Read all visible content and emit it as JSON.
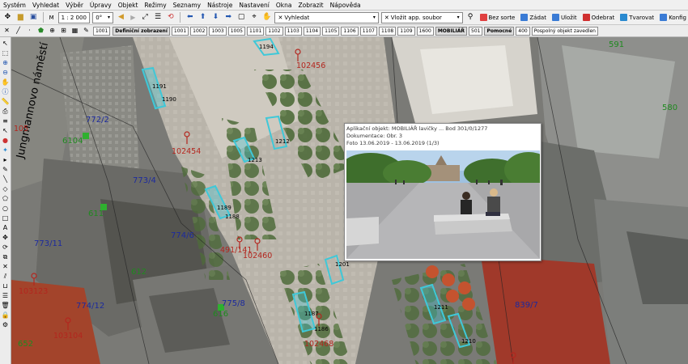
{
  "menu": [
    "Systém",
    "Vyhledat",
    "Výběr",
    "Úpravy",
    "Objekt",
    "Režimy",
    "Seznamy",
    "Nástroje",
    "Nastavení",
    "Okna",
    "Zobrazit",
    "Nápověda"
  ],
  "toolbar": {
    "scale_prefix": "M",
    "scale_value": "1 : 2 000",
    "rotation_value": "0°",
    "search_value": "Vyhledat",
    "search_clear": "✕",
    "file_type_value": "Vložit app. soubor",
    "buttons": {
      "bezsortz": "Bez sorte",
      "zadat": "Zádat",
      "ulozit": "Uložit",
      "odebrat": "Odebrat",
      "tvarovani": "Tvarovat",
      "konfig": "Konfig"
    }
  },
  "layers": {
    "mode_btn": "1001",
    "items": [
      "Definiční zobrazení",
      "1001",
      "1002",
      "1003",
      "1005",
      "1101",
      "1102",
      "1103",
      "1104",
      "1105",
      "1106",
      "1107",
      "1108",
      "1109",
      "1600",
      "MOBILIÁŘ",
      "501",
      "Pomocné",
      "400",
      "Pospolný objekt zavedlen"
    ]
  },
  "map": {
    "street_name": "Jungmannovo náměstí",
    "labels": {
      "red": [
        "102456",
        "102454",
        "102460",
        "102468",
        "103123",
        "103104",
        "491/141",
        "105",
        "124"
      ],
      "blue": [
        "772/2",
        "773/4",
        "774/6",
        "773/11",
        "775/8",
        "774/12",
        "839/7"
      ],
      "green": [
        "591",
        "580",
        "652",
        "612",
        "616",
        "6104",
        "611"
      ],
      "black": [
        "1191",
        "1190",
        "1212",
        "1213",
        "1189",
        "1188",
        "1187",
        "1186",
        "1201",
        "1211",
        "1210",
        "1194",
        "1183"
      ]
    }
  },
  "popup": {
    "title": "Aplikační objekt: MOBILIÁŘ lavičky ... Bod 301/0/1277",
    "subtitle": "Dokumentace: Obr. 3",
    "date": "Foto 13.06.2019 - 13.06.2019 (1/3)"
  },
  "colors": {
    "accent_cyan": "#3fc8d8",
    "label_red": "#b3261e",
    "label_blue": "#1c2a9e",
    "label_green": "#1f8a1f"
  }
}
